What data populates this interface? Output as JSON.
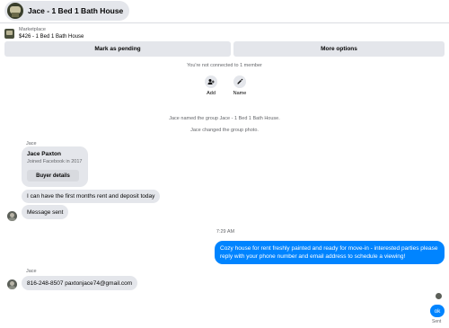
{
  "header": {
    "title": "Jace - 1 Bed 1 Bath House"
  },
  "listing": {
    "label": "Marketplace",
    "summary": "$426 - 1 Bed 1 Bath House"
  },
  "actions": {
    "pending_label": "Mark as pending",
    "more_label": "More options"
  },
  "group": {
    "connection_note": "You're not connected to 1 member",
    "add_label": "Add",
    "name_label": "Name",
    "event_named": "Jace named the group Jace - 1 Bed 1 Bath House.",
    "event_photo": "Jace changed the group photo."
  },
  "thread": {
    "sender_1": "Jace",
    "profile_name": "Jace Paxton",
    "profile_joined": "Joined Facebook in 2017",
    "buyer_details_label": "Buyer details",
    "msg_rent": "I can have the first months rent and deposit today",
    "msg_sent": "Message sent",
    "timestamp": "7:29 AM",
    "msg_outgoing": "Cozy house for rent freshly painted and ready for move-in - interested parties please reply with your phone number and email address to schedule a viewing!",
    "sender_2": "Jace",
    "msg_contact": "816-248-8507 paxtonjace74@gmail.com",
    "msg_ok": "ok",
    "status": "Sent"
  },
  "icons": {
    "add": "add-person-icon",
    "name": "pencil-icon"
  },
  "colors": {
    "outgoing_bubble": "#0084ff",
    "incoming_bubble": "#e4e6eb",
    "secondary_text": "#65676b"
  }
}
